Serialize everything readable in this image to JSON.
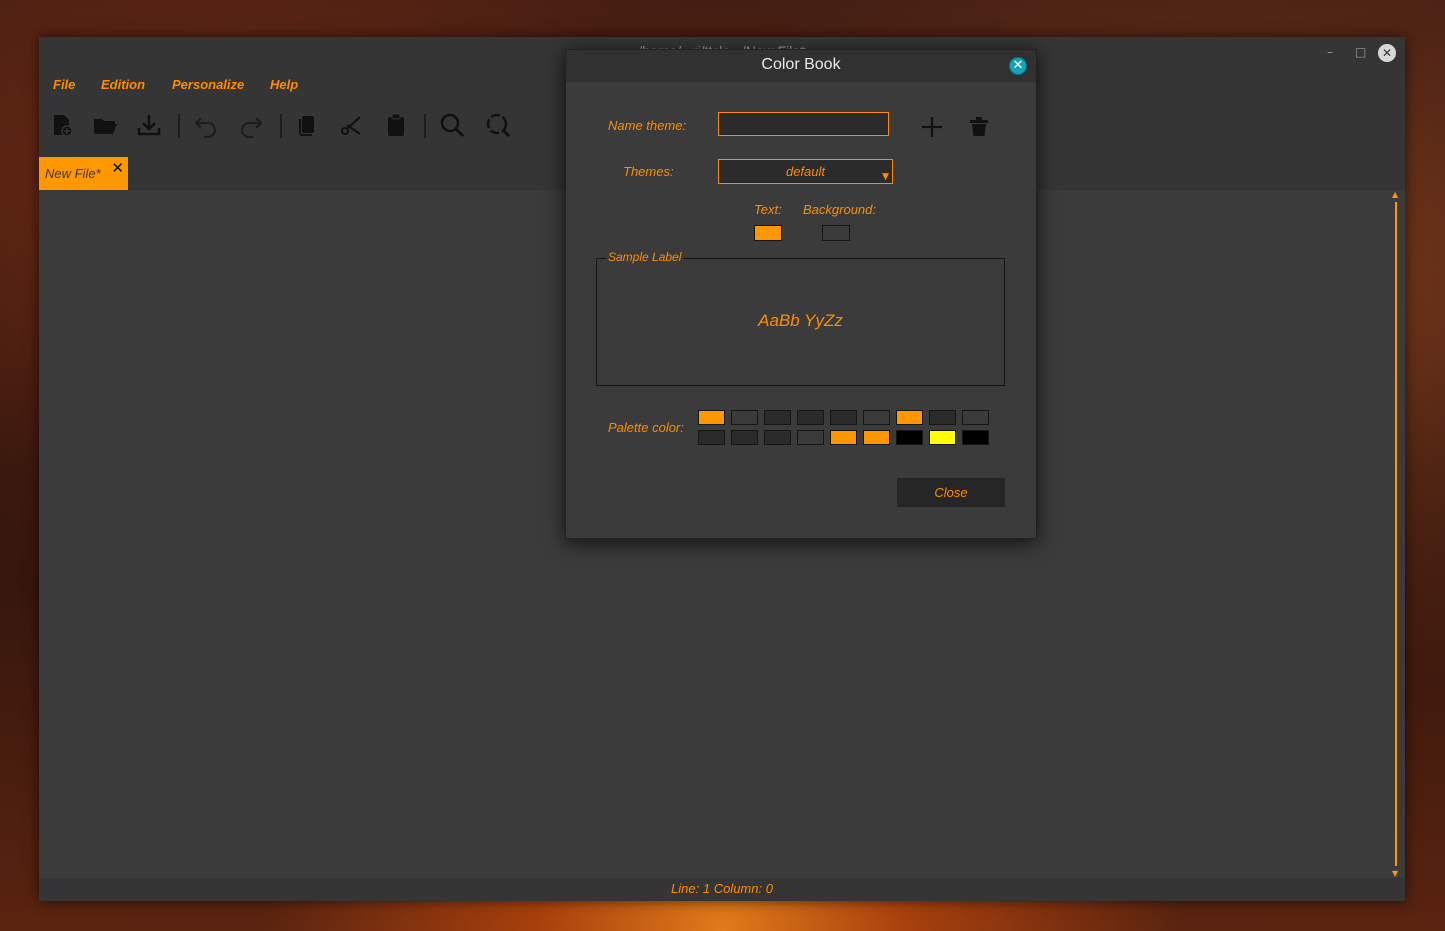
{
  "window": {
    "title": "/home/...ri/ttcle.../New File*",
    "minimize": "–",
    "maximize": "□",
    "close": "✕"
  },
  "menu": [
    "File",
    "Edition",
    "Personalize",
    "Help"
  ],
  "toolbar_icons": [
    "new-file-icon",
    "open-folder-icon",
    "download-icon",
    "undo-icon",
    "redo-icon",
    "copy-icon",
    "cut-icon",
    "paste-icon",
    "search-icon",
    "replace-icon"
  ],
  "tab": {
    "label": "New File*",
    "close": "✕"
  },
  "status": {
    "text": "Line: 1  Column: 0"
  },
  "dialog": {
    "title": "Color Book",
    "close": "✕",
    "name_theme_label": "Name theme:",
    "name_theme_value": "",
    "themes_label": "Themes:",
    "themes_value": "default",
    "text_label": "Text:",
    "background_label": "Background:",
    "text_color": "#ff9800",
    "background_color": "#3b3b3b",
    "sample_legend": "Sample Label",
    "sample_text": "AaBb YyZz",
    "palette_label": "Palette color:",
    "palette_row1": [
      "#ff9800",
      "#3b3b3b",
      "#2b2b2b",
      "#2b2b2b",
      "#2b2b2b",
      "#3b3b3b",
      "#ff9800",
      "#2b2b2b",
      "#3b3b3b"
    ],
    "palette_row2": [
      "#2b2b2b",
      "#2b2b2b",
      "#2b2b2b",
      "#3b3b3b",
      "#ff9800",
      "#ff9800",
      "#000000",
      "#ffff00",
      "#000000"
    ],
    "close_button": "Close"
  },
  "colors": {
    "accent": "#ff8c00",
    "panel": "#3b3b3b",
    "bar": "#353535"
  }
}
